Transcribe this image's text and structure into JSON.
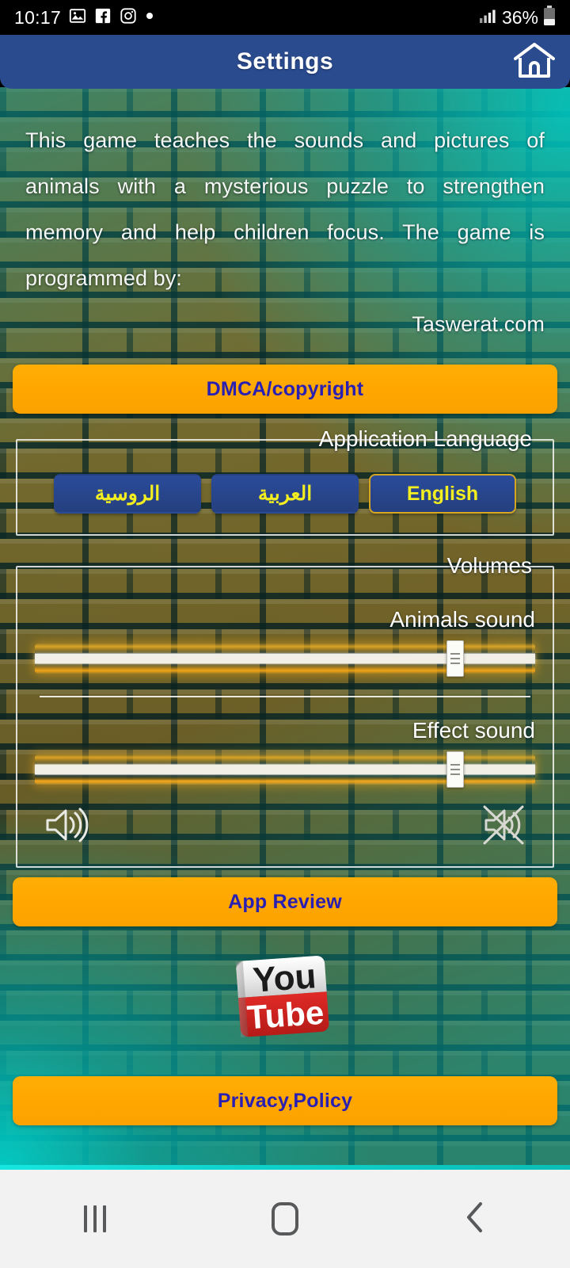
{
  "status_bar": {
    "time": "10:17",
    "icons": [
      "gallery-icon",
      "facebook-icon",
      "instagram-icon",
      "dot-icon"
    ],
    "signal": "signal-bars-icon",
    "battery_percent": "36%",
    "battery_icon": "battery-icon"
  },
  "app_bar": {
    "title": "Settings",
    "home_icon": "home-icon",
    "background_color": "#2b4b8f"
  },
  "description": {
    "body": "This game teaches the sounds and pictures of animals with a mysterious puzzle to strengthen memory and help children focus. The game is programmed by:",
    "credit": "Taswerat.com"
  },
  "buttons": {
    "dmca": "DMCA/copyright",
    "app_review": "App Review",
    "privacy_policy": "Privacy,Policy",
    "accent_color": "#ffa600",
    "label_color": "#2a1fb3"
  },
  "language_section": {
    "legend": "Application Language",
    "options": [
      {
        "label": "الروسية",
        "selected": false
      },
      {
        "label": "العربية",
        "selected": false
      },
      {
        "label": "English",
        "selected": true
      }
    ],
    "button_color": "#2b4b9a",
    "text_color": "#f3ee20",
    "selected_border_color": "#d6a521"
  },
  "volumes_section": {
    "legend": "Volumes",
    "sliders": [
      {
        "label": "Animals sound",
        "value": 84,
        "min": 0,
        "max": 100
      },
      {
        "label": "Effect sound",
        "value": 84,
        "min": 0,
        "max": 100
      }
    ],
    "icons": {
      "left": "volume-up-icon",
      "right": "volume-mute-icon"
    }
  },
  "youtube": {
    "icon": "youtube-logo-icon",
    "top_text": "You",
    "bottom_text": "Tube"
  },
  "nav_bar": {
    "recents": "recents-icon",
    "home": "home-nav-icon",
    "back": "back-icon"
  }
}
